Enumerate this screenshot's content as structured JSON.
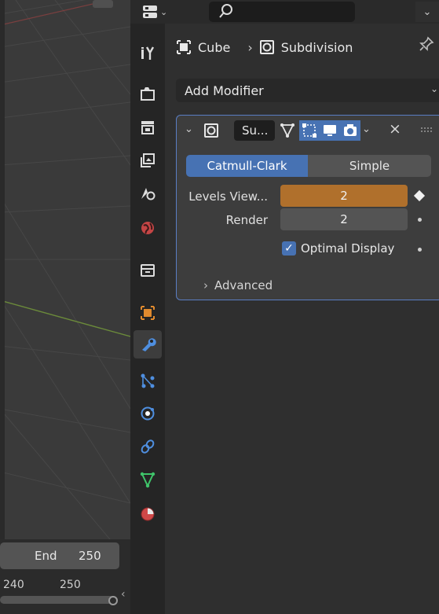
{
  "timeline": {
    "end_label": "End",
    "end_value": "250",
    "ticks": [
      "240",
      "250"
    ]
  },
  "breadcrumb": {
    "object": "Cube",
    "modifier": "Subdivision"
  },
  "add_modifier": "Add Modifier",
  "modifier": {
    "name": "Su...",
    "tabs": {
      "catmull_clark": "Catmull-Clark",
      "simple": "Simple"
    },
    "levels_viewport_label": "Levels View...",
    "levels_viewport_value": "2",
    "render_label": "Render",
    "render_value": "2",
    "optimal_display_label": "Optimal Display",
    "optimal_display_checked": true,
    "advanced_label": "Advanced"
  },
  "colors": {
    "accent_blue": "#4772b3",
    "keyframe_orange": "#b0702c",
    "panel_bg": "#2f2f2f"
  },
  "icons": {
    "tabs": [
      "tool-icon",
      "render-icon",
      "output-icon",
      "view-layer-icon",
      "scene-icon",
      "world-icon",
      "collection-icon",
      "object-icon",
      "modifier-wrench-icon",
      "particles-icon",
      "physics-icon",
      "constraints-icon",
      "object-data-icon",
      "material-icon"
    ]
  }
}
